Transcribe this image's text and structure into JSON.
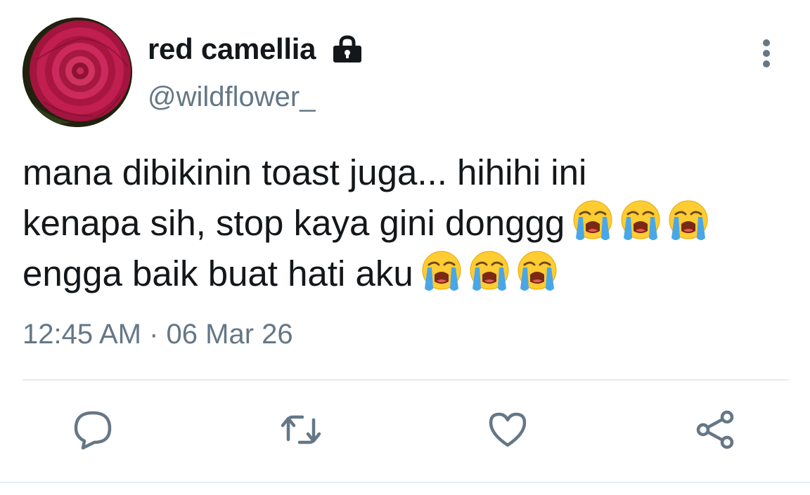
{
  "user": {
    "display_name": "red camellia",
    "handle": "@wildflower_",
    "protected": true,
    "avatar_icon": "red-camellia-flower-avatar"
  },
  "tweet": {
    "line1": "mana dibikinin toast juga... hihihi ini",
    "line2": "kenapa sih, stop kaya gini donggg",
    "line3": "engga baik buat hati aku",
    "emoji_line2": [
      "loudly-crying-face",
      "loudly-crying-face",
      "loudly-crying-face"
    ],
    "emoji_line3": [
      "loudly-crying-face",
      "loudly-crying-face",
      "loudly-crying-face"
    ],
    "timestamp": "12:45 AM · 06 Mar 26"
  },
  "actions": [
    "reply-icon",
    "retweet-icon",
    "like-icon",
    "share-icon"
  ],
  "colors": {
    "text": "#14171a",
    "secondary": "#657786",
    "divider": "#e6ecf0",
    "icon": "#657786"
  }
}
